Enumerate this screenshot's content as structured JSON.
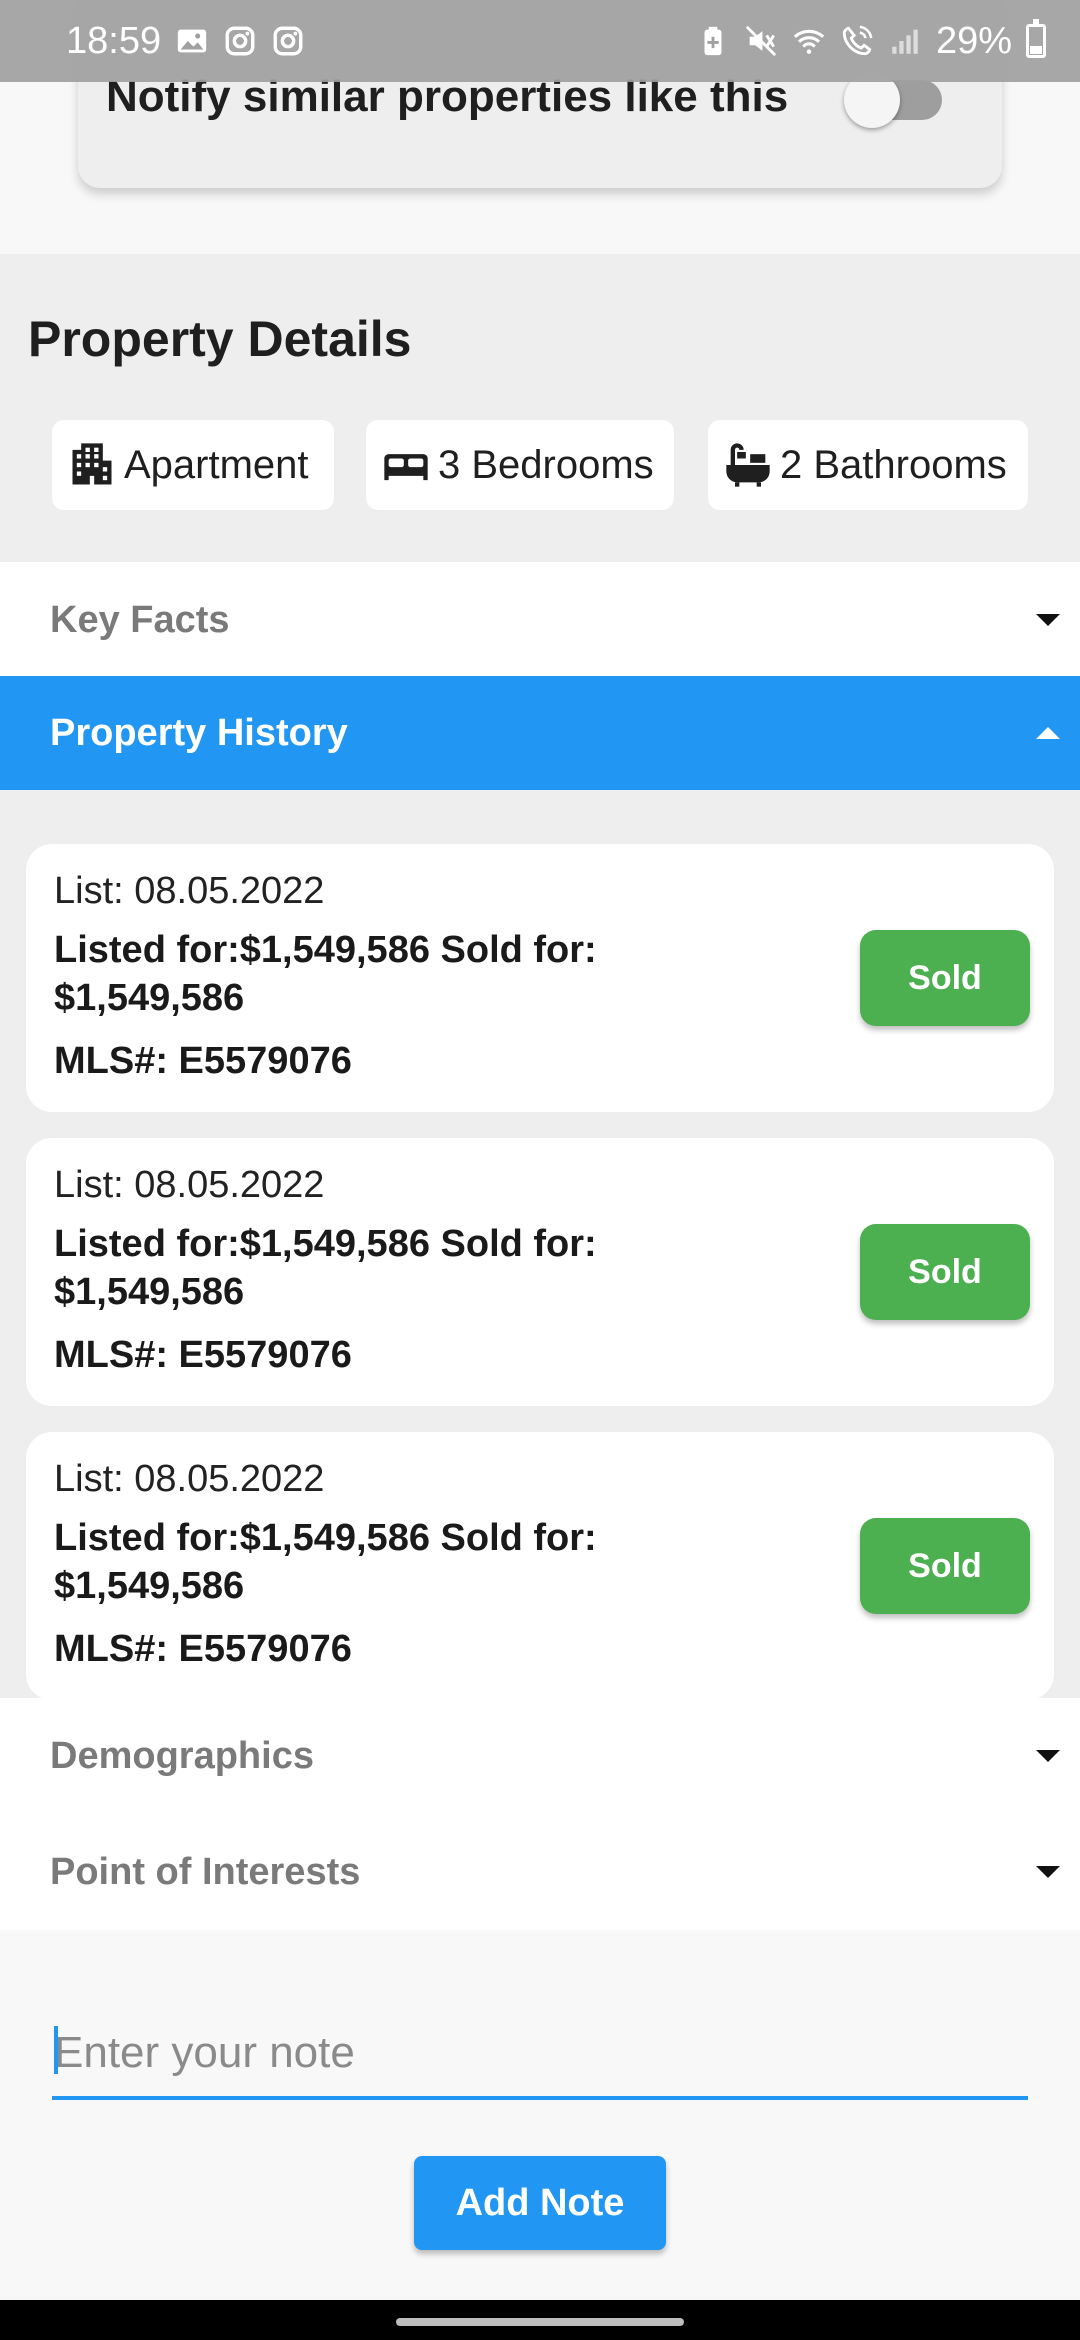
{
  "status_bar": {
    "time": "18:59",
    "battery": "29%",
    "left_icons": [
      "gallery-icon",
      "instagram-icon",
      "instagram-icon"
    ],
    "right_icons": [
      "battery-saver-icon",
      "mute-icon",
      "wifi-icon",
      "wifi-calling-icon",
      "signal-icon"
    ]
  },
  "notify": {
    "label": "Notify similar properties like this",
    "enabled": false
  },
  "details": {
    "title": "Property Details",
    "chips": [
      {
        "icon": "apartment-icon",
        "label": "Apartment"
      },
      {
        "icon": "bed-icon",
        "label": "3 Bedrooms"
      },
      {
        "icon": "bathtub-icon",
        "label": "2 Bathrooms"
      }
    ]
  },
  "accordion": {
    "key_facts": "Key Facts",
    "property_history": "Property History",
    "demographics": "Demographics",
    "points_of_interest": "Point of Interests"
  },
  "history": [
    {
      "list": "List: 08.05.2022",
      "listed": "Listed for:$1,549,586   Sold for: $1,549,586",
      "mls": "MLS#: E5579076",
      "status": "Sold"
    },
    {
      "list": "List: 08.05.2022",
      "listed": "Listed for:$1,549,586   Sold for: $1,549,586",
      "mls": "MLS#: E5579076",
      "status": "Sold"
    },
    {
      "list": "List: 08.05.2022",
      "listed": "Listed for:$1,549,586   Sold for: $1,549,586",
      "mls": "MLS#: E5579076",
      "status": "Sold"
    }
  ],
  "note": {
    "placeholder": "Enter your note",
    "value": "",
    "button": "Add Note"
  },
  "colors": {
    "accent": "#2196f3",
    "sold": "#4caf50"
  }
}
